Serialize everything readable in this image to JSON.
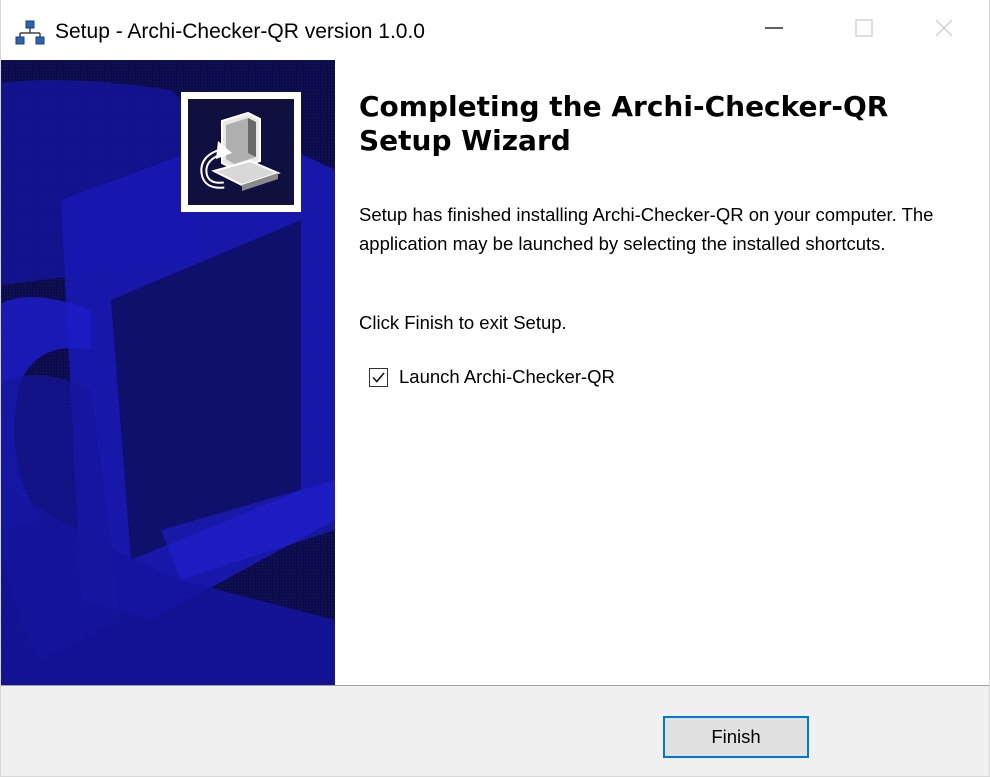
{
  "window": {
    "title": "Setup - Archi-Checker-QR version 1.0.0",
    "controls": [
      "minimize-icon",
      "maximize-icon",
      "close-icon"
    ]
  },
  "banner": {
    "icon": "setup-computer-icon",
    "colors": {
      "background": "#0b0b3a",
      "accent": "#1a1aa8"
    }
  },
  "content": {
    "heading": "Completing the Archi-Checker-QR Setup Wizard",
    "message": "Setup has finished installing Archi-Checker-QR on your computer. The application may be launched by selecting the installed shortcuts.",
    "exit_message": "Click Finish to exit Setup.",
    "launch_checkbox": {
      "label": "Launch Archi-Checker-QR",
      "checked": true
    }
  },
  "footer": {
    "finish_label": "Finish",
    "accent_color": "#0078d7"
  }
}
